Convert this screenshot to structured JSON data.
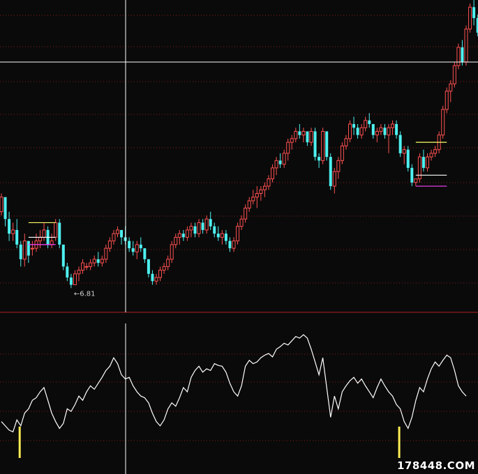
{
  "chart_data": [
    {
      "type": "candlestick",
      "min_label": "←6.81",
      "low_value": 6.81,
      "colors": {
        "up": "#ff5050",
        "down": "#4ef0f0",
        "background": "#0a0a0a",
        "grid": "#8a1b1b",
        "crosshair": "#ffffff"
      },
      "levels": [
        {
          "color": "#ffff66"
        },
        {
          "color": "#ffffff"
        },
        {
          "color": "#ff40ff"
        }
      ],
      "candles": [
        [
          8.9,
          9.4,
          8.8,
          9.3
        ],
        [
          9.3,
          9.3,
          8.5,
          8.7
        ],
        [
          8.7,
          8.9,
          8.1,
          8.3
        ],
        [
          8.3,
          8.6,
          8.1,
          8.4
        ],
        [
          8.4,
          8.7,
          7.9,
          8.0
        ],
        [
          8.0,
          8.1,
          7.4,
          7.6
        ],
        [
          7.6,
          8.3,
          7.4,
          8.1
        ],
        [
          8.1,
          8.1,
          7.5,
          7.7
        ],
        [
          7.9,
          8.1,
          7.7,
          7.9
        ],
        [
          7.9,
          8.3,
          7.8,
          8.1
        ],
        [
          8.1,
          8.4,
          7.9,
          8.2
        ],
        [
          8.2,
          8.6,
          8.1,
          8.4
        ],
        [
          8.4,
          8.5,
          7.9,
          8.0
        ],
        [
          8.0,
          8.3,
          7.9,
          8.1
        ],
        [
          8.2,
          8.7,
          8.1,
          8.6
        ],
        [
          8.6,
          8.7,
          7.9,
          8.0
        ],
        [
          8.0,
          8.0,
          7.3,
          7.4
        ],
        [
          7.4,
          7.5,
          7.0,
          7.1
        ],
        [
          7.1,
          7.2,
          6.81,
          6.9
        ],
        [
          6.9,
          7.3,
          6.9,
          7.2
        ],
        [
          7.2,
          7.4,
          7.0,
          7.3
        ],
        [
          7.3,
          7.6,
          7.2,
          7.5
        ],
        [
          7.4,
          7.5,
          7.3,
          7.4
        ],
        [
          7.4,
          7.6,
          7.3,
          7.5
        ],
        [
          7.5,
          7.7,
          7.4,
          7.6
        ],
        [
          7.6,
          7.8,
          7.4,
          7.5
        ],
        [
          7.5,
          7.7,
          7.4,
          7.6
        ],
        [
          7.6,
          8.0,
          7.5,
          7.9
        ],
        [
          7.9,
          8.2,
          7.8,
          8.1
        ],
        [
          8.1,
          8.4,
          8.0,
          8.3
        ],
        [
          8.3,
          8.5,
          8.2,
          8.4
        ],
        [
          8.4,
          8.4,
          8.0,
          8.2
        ],
        [
          8.2,
          8.5,
          8.0,
          8.1
        ],
        [
          8.1,
          8.2,
          7.8,
          7.9
        ],
        [
          7.9,
          8.1,
          7.7,
          7.8
        ],
        [
          7.8,
          8.1,
          7.6,
          8.0
        ],
        [
          8.0,
          8.2,
          7.8,
          7.9
        ],
        [
          7.9,
          7.9,
          7.5,
          7.6
        ],
        [
          7.6,
          7.6,
          7.1,
          7.2
        ],
        [
          7.2,
          7.3,
          6.9,
          7.0
        ],
        [
          7.0,
          7.2,
          6.9,
          7.1
        ],
        [
          7.1,
          7.4,
          7.0,
          7.3
        ],
        [
          7.3,
          7.5,
          7.2,
          7.4
        ],
        [
          7.4,
          7.7,
          7.3,
          7.6
        ],
        [
          7.6,
          8.1,
          7.5,
          8.0
        ],
        [
          8.0,
          8.3,
          7.9,
          8.2
        ],
        [
          8.2,
          8.4,
          8.0,
          8.3
        ],
        [
          8.3,
          8.4,
          8.1,
          8.2
        ],
        [
          8.2,
          8.5,
          8.1,
          8.4
        ],
        [
          8.4,
          8.6,
          8.2,
          8.5
        ],
        [
          8.5,
          8.6,
          8.2,
          8.3
        ],
        [
          8.3,
          8.7,
          8.2,
          8.6
        ],
        [
          8.6,
          8.7,
          8.3,
          8.4
        ],
        [
          8.4,
          8.8,
          8.3,
          8.7
        ],
        [
          8.7,
          8.9,
          8.4,
          8.5
        ],
        [
          8.5,
          8.6,
          8.2,
          8.3
        ],
        [
          8.3,
          8.5,
          8.1,
          8.2
        ],
        [
          8.2,
          8.4,
          8.0,
          8.3
        ],
        [
          8.3,
          8.4,
          8.0,
          8.1
        ],
        [
          8.1,
          8.2,
          7.8,
          7.9
        ],
        [
          7.9,
          8.2,
          7.8,
          8.1
        ],
        [
          8.1,
          8.6,
          8.0,
          8.5
        ],
        [
          8.5,
          8.8,
          8.4,
          8.7
        ],
        [
          8.7,
          9.1,
          8.6,
          9.0
        ],
        [
          9.0,
          9.3,
          8.9,
          9.2
        ],
        [
          9.2,
          9.5,
          9.1,
          9.3
        ],
        [
          9.3,
          9.6,
          9.0,
          9.4
        ],
        [
          9.4,
          9.6,
          9.2,
          9.5
        ],
        [
          9.5,
          9.7,
          9.3,
          9.6
        ],
        [
          9.6,
          9.9,
          9.5,
          9.8
        ],
        [
          9.8,
          10.2,
          9.7,
          10.1
        ],
        [
          10.1,
          10.4,
          9.9,
          10.3
        ],
        [
          10.3,
          10.5,
          10.1,
          10.2
        ],
        [
          10.2,
          10.6,
          10.1,
          10.5
        ],
        [
          10.5,
          10.9,
          10.3,
          10.8
        ],
        [
          10.8,
          11.0,
          10.6,
          10.9
        ],
        [
          10.9,
          11.2,
          10.8,
          11.1
        ],
        [
          11.1,
          11.3,
          10.9,
          11.0
        ],
        [
          11.0,
          11.2,
          10.8,
          11.1
        ],
        [
          11.1,
          11.1,
          10.7,
          10.8
        ],
        [
          10.8,
          11.2,
          10.7,
          11.1
        ],
        [
          11.1,
          11.2,
          10.3,
          10.4
        ],
        [
          10.4,
          10.5,
          10.1,
          10.3
        ],
        [
          10.3,
          11.2,
          10.2,
          11.1
        ],
        [
          11.1,
          11.1,
          10.3,
          10.4
        ],
        [
          10.4,
          10.5,
          9.5,
          9.6
        ],
        [
          9.6,
          10.1,
          9.4,
          10.0
        ],
        [
          10.0,
          10.4,
          9.8,
          10.3
        ],
        [
          10.3,
          10.8,
          10.2,
          10.7
        ],
        [
          10.7,
          11.0,
          10.6,
          10.9
        ],
        [
          10.9,
          11.4,
          10.8,
          11.3
        ],
        [
          11.3,
          11.5,
          11.0,
          11.2
        ],
        [
          11.2,
          11.3,
          10.9,
          11.0
        ],
        [
          11.0,
          11.3,
          10.9,
          11.2
        ],
        [
          11.2,
          11.5,
          11.1,
          11.4
        ],
        [
          11.4,
          11.6,
          11.2,
          11.3
        ],
        [
          11.3,
          11.3,
          10.9,
          11.0
        ],
        [
          11.0,
          11.2,
          10.8,
          11.1
        ],
        [
          11.1,
          11.3,
          11.0,
          11.2
        ],
        [
          11.2,
          11.3,
          10.9,
          11.0
        ],
        [
          11.0,
          11.3,
          10.5,
          11.2
        ],
        [
          11.2,
          11.4,
          11.0,
          11.3
        ],
        [
          11.3,
          11.4,
          10.9,
          11.0
        ],
        [
          11.0,
          11.1,
          10.4,
          10.5
        ],
        [
          10.5,
          10.7,
          10.2,
          10.6
        ],
        [
          10.6,
          10.7,
          10.0,
          10.1
        ],
        [
          10.1,
          10.2,
          9.6,
          9.7
        ],
        [
          9.7,
          9.8,
          9.6,
          9.8
        ],
        [
          9.8,
          10.5,
          9.7,
          10.4
        ],
        [
          10.4,
          10.6,
          10.0,
          10.1
        ],
        [
          10.1,
          10.5,
          10.0,
          10.4
        ],
        [
          10.4,
          10.6,
          10.3,
          10.5
        ],
        [
          10.5,
          10.7,
          10.4,
          10.6
        ],
        [
          10.6,
          11.1,
          10.5,
          11.0
        ],
        [
          11.0,
          11.8,
          10.9,
          11.7
        ],
        [
          11.7,
          12.3,
          11.6,
          12.2
        ],
        [
          12.2,
          12.5,
          11.9,
          12.4
        ],
        [
          12.4,
          13.0,
          12.3,
          12.9
        ],
        [
          12.9,
          13.5,
          12.8,
          13.4
        ],
        [
          13.4,
          13.6,
          12.9,
          13.0
        ],
        [
          13.0,
          14.0,
          12.9,
          13.9
        ],
        [
          13.9,
          14.6,
          13.8,
          14.5
        ],
        [
          14.5,
          14.8,
          14.0,
          14.2
        ],
        [
          14.2,
          14.3,
          13.7,
          13.8
        ]
      ],
      "y_range": [
        6.3,
        14.6
      ],
      "indicator": {
        "values": [
          0.2,
          0.15,
          0.1,
          0.08,
          0.22,
          0.15,
          0.3,
          0.35,
          0.45,
          0.48,
          0.55,
          0.6,
          0.45,
          0.3,
          0.2,
          0.12,
          0.18,
          0.35,
          0.32,
          0.4,
          0.5,
          0.45,
          0.55,
          0.62,
          0.58,
          0.65,
          0.72,
          0.8,
          0.85,
          0.95,
          0.88,
          0.75,
          0.7,
          0.72,
          0.62,
          0.55,
          0.5,
          0.48,
          0.42,
          0.3,
          0.2,
          0.15,
          0.22,
          0.35,
          0.42,
          0.38,
          0.48,
          0.6,
          0.55,
          0.72,
          0.8,
          0.85,
          0.78,
          0.82,
          0.8,
          0.88,
          0.86,
          0.85,
          0.78,
          0.65,
          0.55,
          0.5,
          0.62,
          0.85,
          0.92,
          0.88,
          0.9,
          0.95,
          0.98,
          1.0,
          0.96,
          1.05,
          1.08,
          1.12,
          1.1,
          1.15,
          1.2,
          1.18,
          1.22,
          1.18,
          1.05,
          0.9,
          0.75,
          0.95,
          0.6,
          0.25,
          0.5,
          0.35,
          0.55,
          0.62,
          0.68,
          0.72,
          0.65,
          0.7,
          0.62,
          0.55,
          0.48,
          0.6,
          0.7,
          0.62,
          0.55,
          0.5,
          0.4,
          0.35,
          0.2,
          0.12,
          0.25,
          0.45,
          0.6,
          0.55,
          0.7,
          0.82,
          0.9,
          0.85,
          0.92,
          0.98,
          0.95,
          0.8,
          0.62,
          0.55,
          0.5
        ],
        "y_range": [
          -0.35,
          1.32
        ],
        "markers": [
          {
            "index": 4
          },
          {
            "index": 102
          }
        ],
        "marker_color": "#ffee55",
        "line_color": "#ffffff"
      },
      "crosshair_index": 19,
      "crosshair_value": 12.9
    }
  ],
  "watermark": "178448.COM"
}
